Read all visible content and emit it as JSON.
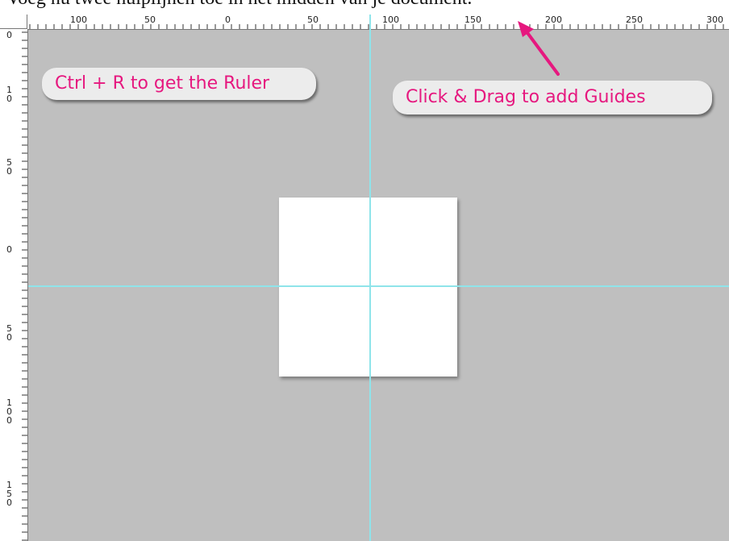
{
  "caption": "Voeg nu twee hulplijnen toe in het midden van je document.",
  "callouts": {
    "ruler": "Ctrl + R to get the Ruler",
    "guides": "Click & Drag to add Guides"
  },
  "ruler": {
    "horizontal_labels": [
      "100",
      "50",
      "0",
      "50",
      "100",
      "150",
      "200",
      "250",
      "300"
    ],
    "vertical_labels": [
      "0",
      "10",
      "50",
      "0",
      "50",
      "100",
      "150"
    ]
  },
  "colors": {
    "accent": "#e6187f",
    "guide": "#8fe4ea",
    "canvas": "#bfbfbf"
  }
}
